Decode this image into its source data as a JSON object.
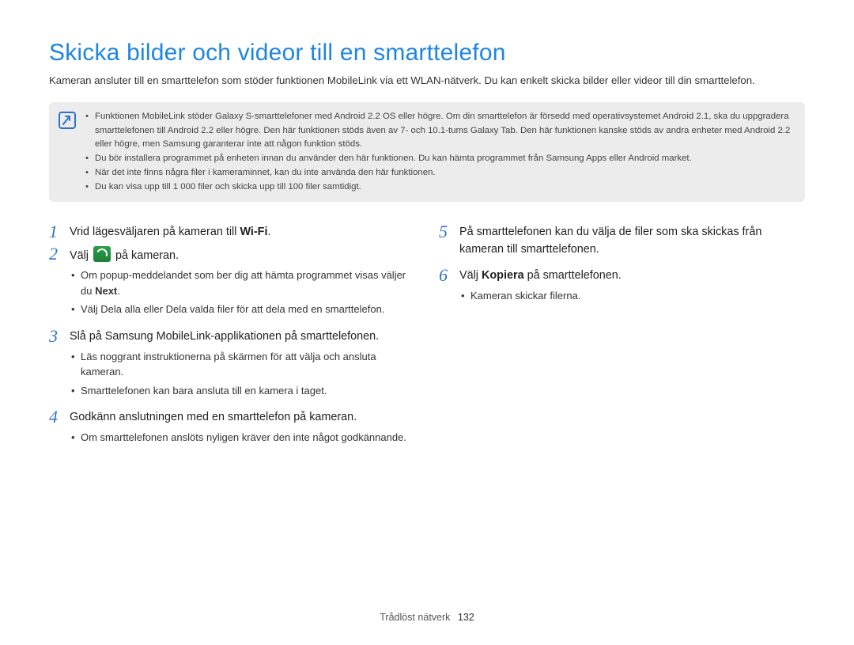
{
  "title": "Skicka bilder och videor till en smarttelefon",
  "intro": "Kameran ansluter till en smarttelefon som stöder funktionen MobileLink via ett WLAN-nätverk. Du kan enkelt skicka bilder eller videor till din smarttelefon.",
  "notes": [
    "Funktionen MobileLink stöder Galaxy S-smarttelefoner med Android 2.2 OS eller högre. Om din smarttelefon är försedd med operativsystemet Android 2.1, ska du uppgradera smarttelefonen till Android 2.2 eller högre. Den här funktionen stöds även av 7- och 10.1-tums Galaxy Tab. Den här funktionen kanske stöds av andra enheter med Android 2.2 eller högre, men Samsung garanterar inte att någon funktion stöds.",
    "Du bör installera programmet på enheten innan du använder den här funktionen. Du kan hämta programmet från Samsung Apps eller Android market.",
    "När det inte finns några filer i kameraminnet, kan du inte använda den här funktionen.",
    "Du kan visa upp till 1 000 filer och skicka upp till 100 filer samtidigt."
  ],
  "step1": {
    "num": "1",
    "pre": "Vrid lägesväljaren på kameran till ",
    "wifi": "Wi-Fi",
    "post": "."
  },
  "step2": {
    "num": "2",
    "pre": "Välj ",
    "icon_name": "mobilelink-icon",
    "post": " på kameran.",
    "sub_a_pre": "Om popup-meddelandet som ber dig att hämta programmet visas väljer du ",
    "sub_a_bold": "Next",
    "sub_a_post": ".",
    "sub_b": "Välj Dela alla eller Dela valda filer för att dela med en smarttelefon."
  },
  "step3": {
    "num": "3",
    "text": "Slå på Samsung MobileLink-applikationen på smarttelefonen.",
    "sub_a": "Läs noggrant instruktionerna på skärmen för att välja och ansluta kameran.",
    "sub_b": "Smarttelefonen kan bara ansluta till en kamera i taget."
  },
  "step4": {
    "num": "4",
    "text": "Godkänn anslutningen med en smarttelefon på kameran.",
    "sub_a": "Om smarttelefonen anslöts nyligen kräver den inte något godkännande."
  },
  "step5": {
    "num": "5",
    "text": "På smarttelefonen kan du välja de filer som ska skickas från kameran till smarttelefonen."
  },
  "step6": {
    "num": "6",
    "pre": "Välj ",
    "bold": "Kopiera",
    "post": " på smarttelefonen.",
    "sub_a": "Kameran skickar filerna."
  },
  "footer": {
    "section": "Trådlöst nätverk",
    "page": "132"
  }
}
